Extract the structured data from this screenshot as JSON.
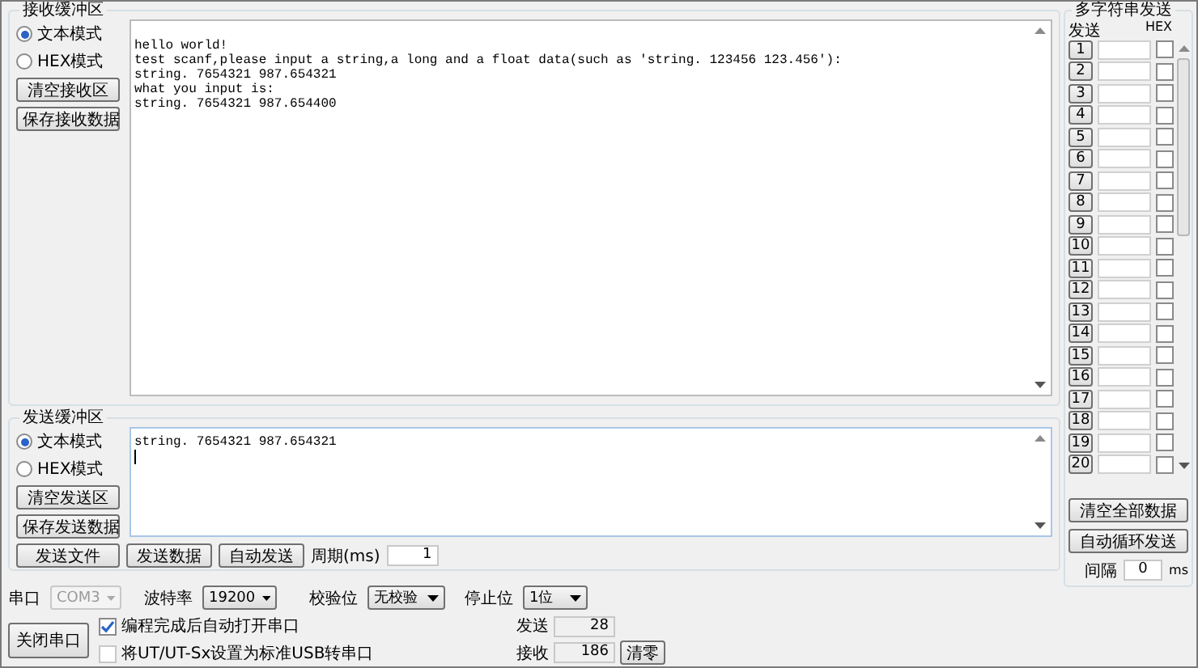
{
  "receive": {
    "title": "接收缓冲区",
    "modes": [
      {
        "label": "文本模式",
        "selected": true
      },
      {
        "label": "HEX模式",
        "selected": false
      }
    ],
    "buttons": [
      "清空接收区",
      "保存接收数据"
    ],
    "lines": [
      "hello world!",
      "test scanf,please input a string,a long and a float data(such as 'string. 123456 123.456'):",
      "string. 7654321 987.654321",
      "what you input is:",
      "string. 7654321 987.654400"
    ]
  },
  "send": {
    "title": "发送缓冲区",
    "modes": [
      {
        "label": "文本模式",
        "selected": true
      },
      {
        "label": "HEX模式",
        "selected": false
      }
    ],
    "buttons": [
      "清空发送区",
      "保存发送数据"
    ],
    "text": "string. 7654321 987.654321",
    "actions": [
      "发送文件",
      "发送数据",
      "自动发送"
    ],
    "period_label": "周期(ms)",
    "period_value": "1"
  },
  "serial": {
    "port_label": "串口",
    "port_value": "COM3",
    "port_disabled": true,
    "baud_label": "波特率",
    "baud_value": "19200",
    "parity_label": "校验位",
    "parity_value": "无校验",
    "stop_label": "停止位",
    "stop_value": "1位",
    "close_button": "关闭串口",
    "options": [
      {
        "label": "编程完成后自动打开串口",
        "checked": true,
        "disabled": false
      },
      {
        "label": "将UT/UT-Sx设置为标准USB转串口",
        "checked": false,
        "disabled": true
      }
    ],
    "sent_label": "发送",
    "sent_value": "28",
    "received_label": "接收",
    "received_value": "186",
    "reset_button": "清零"
  },
  "multi": {
    "title": "多字符串发送",
    "header_send": "发送",
    "header_hex": "HEX",
    "rows": [
      {
        "label": "1",
        "hex": false
      },
      {
        "label": "2",
        "hex": false
      },
      {
        "label": "3",
        "hex": false
      },
      {
        "label": "4",
        "hex": false
      },
      {
        "label": "5",
        "hex": false
      },
      {
        "label": "6",
        "hex": false
      },
      {
        "label": "7",
        "hex": false
      },
      {
        "label": "8",
        "hex": false
      },
      {
        "label": "9",
        "hex": false
      },
      {
        "label": "10",
        "hex": false
      },
      {
        "label": "11",
        "hex": false
      },
      {
        "label": "12",
        "hex": false
      },
      {
        "label": "13",
        "hex": false
      },
      {
        "label": "14",
        "hex": false
      },
      {
        "label": "15",
        "hex": false
      },
      {
        "label": "16",
        "hex": false
      },
      {
        "label": "17",
        "hex": false
      },
      {
        "label": "18",
        "hex": false
      },
      {
        "label": "19",
        "hex": false
      },
      {
        "label": "20",
        "hex": false
      }
    ],
    "buttons": [
      "清空全部数据",
      "自动循环发送"
    ],
    "interval_label": "间隔",
    "interval_value": "0",
    "interval_unit": "ms"
  }
}
